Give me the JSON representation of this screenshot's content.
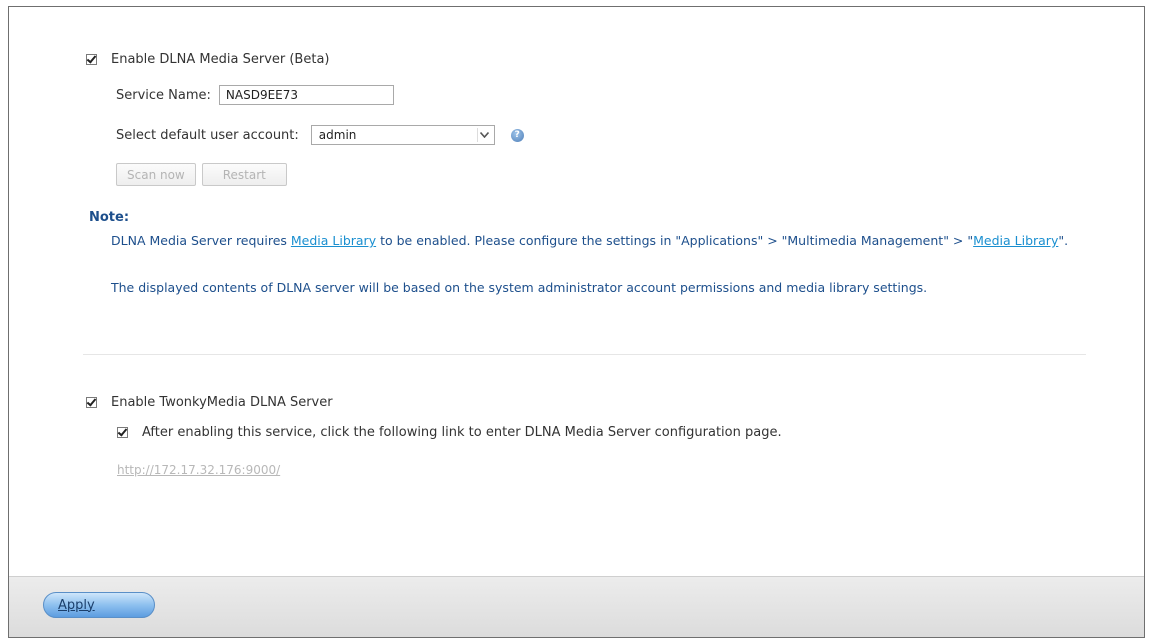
{
  "dlna": {
    "enable_label": "Enable DLNA Media Server (Beta)",
    "service_name_label": "Service Name:",
    "service_name_value": "NASD9EE73",
    "default_user_label": "Select default user account:",
    "default_user_value": "admin",
    "scan_now_label": "Scan now",
    "restart_label": "Restart"
  },
  "note": {
    "title": "Note:",
    "line1_prefix": "DLNA Media Server requires ",
    "line1_link": "Media Library",
    "line1_middle": " to be enabled. Please configure the settings in \"Applications\" > \"Multimedia Management\" > \"",
    "line1_link2": "Media Library",
    "line1_suffix": "\".",
    "line2": "The displayed contents of DLNA server will be based on the system administrator account permissions and media library settings."
  },
  "twonky": {
    "enable_label": "Enable TwonkyMedia DLNA Server",
    "sub_label": "After enabling this service, click the following link to enter DLNA Media Server configuration page.",
    "url": "http://172.17.32.176:9000/"
  },
  "footer": {
    "apply_label": "Apply"
  },
  "icons": {
    "help": "help-icon",
    "dropdown": "chevron-down-icon",
    "check": "checkbox-check-icon"
  }
}
